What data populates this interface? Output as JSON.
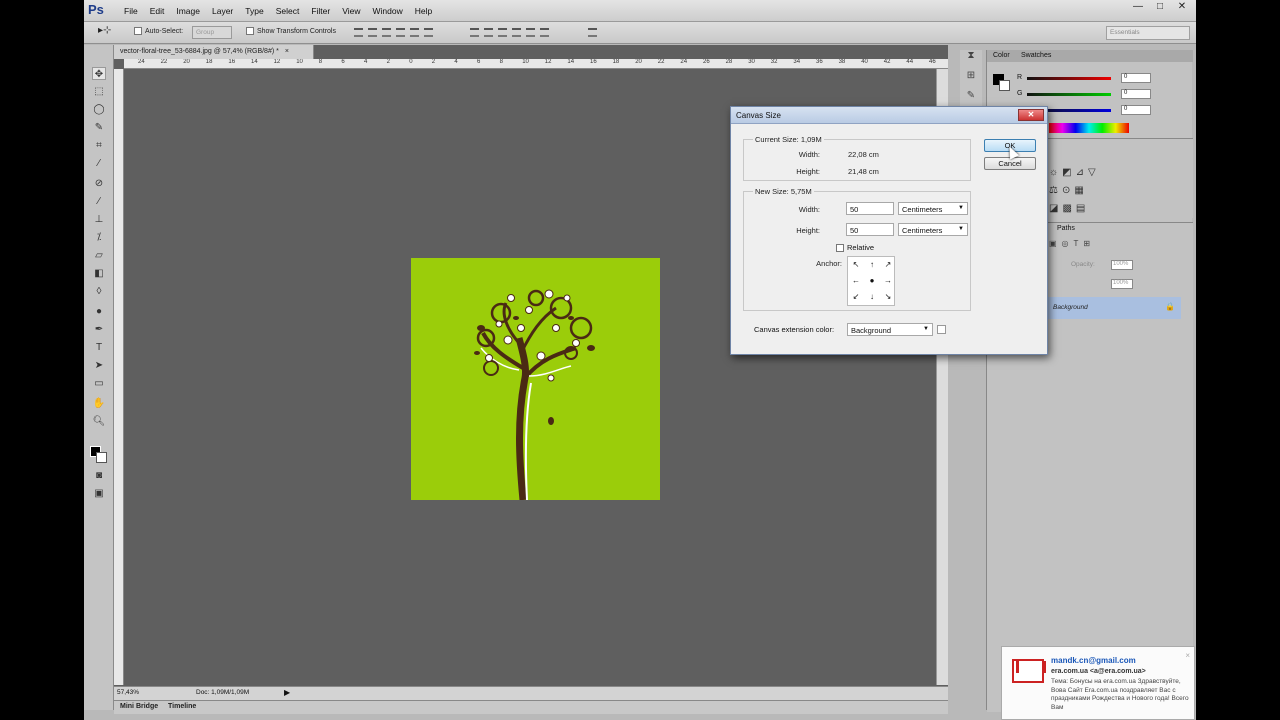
{
  "app": {
    "logo": "Ps"
  },
  "menu": [
    "File",
    "Edit",
    "Image",
    "Layer",
    "Type",
    "Select",
    "Filter",
    "View",
    "Window",
    "Help"
  ],
  "window_controls": {
    "minimize": "—",
    "maximize": "□",
    "close": "✕"
  },
  "options_bar": {
    "auto_select": "Auto-Select:",
    "group": "Group",
    "show_transform": "Show Transform Controls",
    "workspace": "Essentials"
  },
  "document": {
    "tab_title": "vector-floral-tree_53-6884.jpg @ 57,4% (RGB/8#) *",
    "tab_close": "×",
    "ruler_h": [
      "24",
      "22",
      "20",
      "18",
      "16",
      "14",
      "12",
      "10",
      "8",
      "6",
      "4",
      "2",
      "0",
      "2",
      "4",
      "6",
      "8",
      "10",
      "12",
      "14",
      "16",
      "18",
      "20",
      "22",
      "24",
      "26",
      "28",
      "30",
      "32",
      "34",
      "36",
      "38",
      "40",
      "42",
      "44",
      "46"
    ],
    "zoom": "57,43%",
    "doc_size": "Doc: 1,09M/1,09M"
  },
  "bottom_tabs": {
    "mini_bridge": "Mini Bridge",
    "timeline": "Timeline"
  },
  "right_panel": {
    "color_tab": "Color",
    "swatches_tab": "Swatches",
    "r_label": "R",
    "g_label": "G",
    "b_label": "B",
    "r_val": "0",
    "g_val": "0",
    "b_val": "0",
    "paths_tab": "Paths",
    "opacity_lbl": "Opacity:",
    "opacity_val": "100%",
    "fill_val": "100%",
    "layer_name": "Background",
    "lock": "🔒"
  },
  "dialog": {
    "title": "Canvas Size",
    "close": "✕",
    "current_size": "Current Size: 1,09M",
    "width_lbl": "Width:",
    "height_lbl": "Height:",
    "cur_width": "22,08 cm",
    "cur_height": "21,48 cm",
    "new_size": "New Size: 5,75M",
    "new_width": "50",
    "new_height": "50",
    "unit_w": "Centimeters",
    "unit_h": "Centimeters",
    "relative": "Relative",
    "anchor": "Anchor:",
    "anchor_cells": [
      "↖",
      "↑",
      "↗",
      "←",
      "●",
      "→",
      "↙",
      "↓",
      "↘"
    ],
    "ext_color_lbl": "Canvas extension color:",
    "ext_color_val": "Background",
    "ok": "OK",
    "cancel": "Cancel"
  },
  "notification": {
    "email": "mandk.cn@gmail.com",
    "from": "era.com.ua <a@era.com.ua>",
    "body": "Тема: Бонусы на era.com.ua Здравствуйте, Вова Сайт Era.com.ua поздравляет Вас с праздниками Рождества и Нового года! Всего Вам",
    "close": "×"
  },
  "colors": {
    "canvas_green": "#9bcd0a",
    "workspace": "#5f5f5f",
    "trunk": "#4a2a14"
  }
}
